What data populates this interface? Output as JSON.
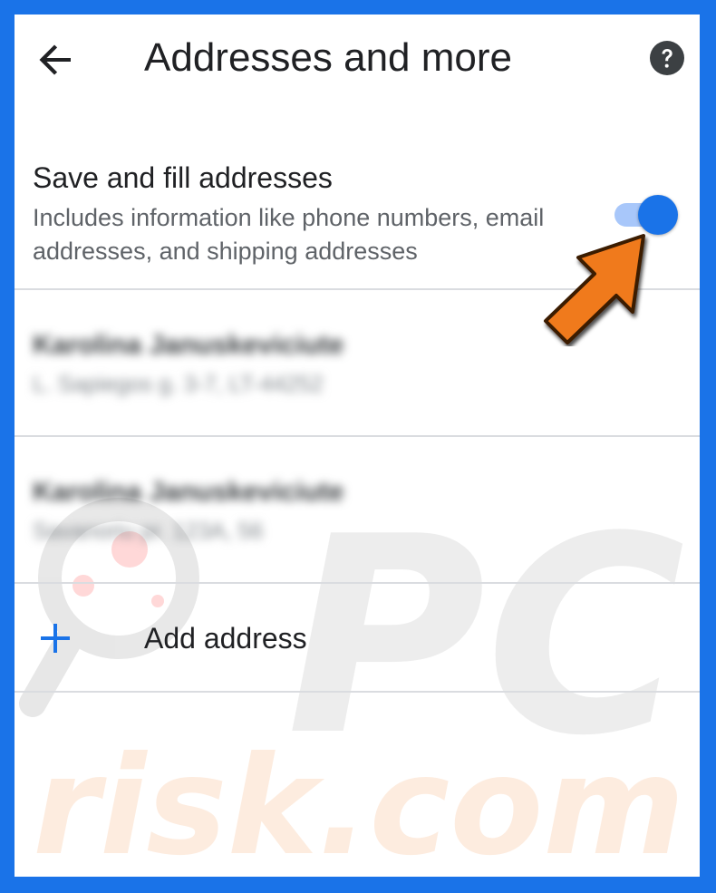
{
  "header": {
    "title": "Addresses and more",
    "back_icon": "arrow-left-icon",
    "help_icon": "help-circle-icon"
  },
  "setting": {
    "title": "Save and fill addresses",
    "description": "Includes information like phone numbers, email addresses, and shipping addresses",
    "toggle_on": true
  },
  "addresses": [
    {
      "name": "Karolina Januskeviciute",
      "line": "L. Sapiegos g. 3-7, LT-44252"
    },
    {
      "name": "Karolina Januskeviciute",
      "line": "Savanoriu pr. 123A, 56"
    }
  ],
  "add_address": {
    "label": "Add address",
    "icon": "plus-icon"
  },
  "watermark": {
    "text": "risk.com",
    "logo": "PC"
  },
  "colors": {
    "frame": "#1a73e8",
    "accent": "#1a73e8",
    "track": "#a8c7fa",
    "pointer": "#f07a1c"
  }
}
